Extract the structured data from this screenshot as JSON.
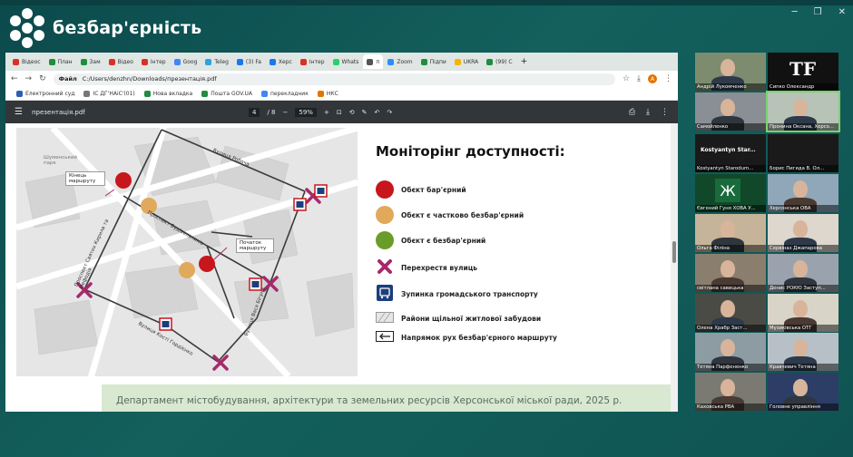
{
  "brand": {
    "name": "безбар'єрність"
  },
  "browser": {
    "tabs": [
      {
        "label": "Відеос",
        "color": "#d93025"
      },
      {
        "label": "План",
        "color": "#1e8e3e"
      },
      {
        "label": "Зам",
        "color": "#1e8e3e"
      },
      {
        "label": "Відео",
        "color": "#d93025"
      },
      {
        "label": "Інтер",
        "color": "#d93025"
      },
      {
        "label": "Goog",
        "color": "#4285f4"
      },
      {
        "label": "Teleg",
        "color": "#2aa3de"
      },
      {
        "label": "(3) Fa",
        "color": "#1877f2"
      },
      {
        "label": "Херс",
        "color": "#1877f2"
      },
      {
        "label": "Інтер",
        "color": "#d93025"
      },
      {
        "label": "Whats",
        "color": "#25d366"
      },
      {
        "label": "п",
        "color": "#555555"
      },
      {
        "label": "Zoom",
        "color": "#2d8cff"
      },
      {
        "label": "Підпи",
        "color": "#1e8e3e"
      },
      {
        "label": "UKRA",
        "color": "#f4b400"
      },
      {
        "label": "(99) С",
        "color": "#1e8e3e"
      }
    ],
    "address": {
      "scheme": "Файл",
      "path": "C:/Users/denzhn/Downloads/презентація.pdf"
    },
    "bookmarks": [
      "Електронний суд",
      "ІС ДГ'НАіС'(01)",
      "Нова вкладка",
      "Пошта GOV.UA",
      "перекладник",
      "НКС"
    ],
    "profile_initial": "A"
  },
  "pdf": {
    "filename": "презентація.pdf",
    "page_current": "4",
    "page_total": "/ 8",
    "zoom": "59%",
    "slide": {
      "title": "Моніторінг доступності:",
      "legend": [
        {
          "label": "Обєкт бар'єрний",
          "type": "dot",
          "color": "#c8161d"
        },
        {
          "label": "Обєкт є частково безбар'єрний",
          "type": "dot",
          "color": "#e0a95c"
        },
        {
          "label": "Обєкт є безбар'єрний",
          "type": "dot",
          "color": "#6a9c2a"
        },
        {
          "label": "Перехрестя вулиць",
          "type": "cross",
          "color": "#a52a6b"
        },
        {
          "label": "Зупинка громадського транспорту",
          "type": "bus",
          "color": "#1b3f7a"
        },
        {
          "label": "Райони щільної житлової забудови",
          "type": "hatch",
          "color": "#bdbdbd"
        },
        {
          "label": "Напрямок рух безбар'єрного маршруту",
          "type": "arrow",
          "color": "#222222"
        }
      ],
      "map_labels": {
        "end": "Кінець маршруту",
        "start": "Початок маршруту",
        "park": "Шуменський парк",
        "street1": "Вулиця Робоча",
        "street2": "Проспект Будівельників",
        "street3": "Проспект Святих Кирила та Мефодія",
        "street4": "Вулиця Вася Бігуна",
        "street5": "Вулиця Кості Гордієнко"
      },
      "footer": "Департамент містобудування, архітектури та земельних ресурсів Херсонської міської ради, 2025 р."
    }
  },
  "participants": [
    {
      "name": "Андрій Лукомченко",
      "bg": "#7d8c6e"
    },
    {
      "name": "Сипко Олександр",
      "bg": "#111111"
    },
    {
      "name": "Самойленко",
      "bg": "#8a8f95"
    },
    {
      "name": "Пронина Оксана, Херсо...",
      "bg": "#b7c3b6"
    },
    {
      "name": "Kostyantyn Starodum...",
      "bg": "#1a1a1a"
    },
    {
      "name": "Борис Пигида В. Ол...",
      "bg": "#1a1a1a"
    },
    {
      "name": "Євгений Гуня ХОВА У...",
      "bg": "#11482a"
    },
    {
      "name": "Херсонська ОВА",
      "bg": "#8fa7b8"
    },
    {
      "name": "Ольга Філіна",
      "bg": "#c5b49a"
    },
    {
      "name": "Сервіназ Джапарова",
      "bg": "#ddd7ce"
    },
    {
      "name": "світлана савицька",
      "bg": "#8a7f6e"
    },
    {
      "name": "Денис РОКЮ Заступ...",
      "bg": "#9aa3ad"
    },
    {
      "name": "Олена Храбр Заст...",
      "bg": "#4b4b46"
    },
    {
      "name": "Музиківська ОТГ",
      "bg": "#d9d4c8"
    },
    {
      "name": "Тетяна Парфененко",
      "bg": "#8c9ca2"
    },
    {
      "name": "Кравчевич Тетяна",
      "bg": "#b8c0c7"
    },
    {
      "name": "Каховська РВА",
      "bg": "#7a7a72"
    },
    {
      "name": "Головне управління",
      "bg": "#2c3e66"
    }
  ],
  "tile7_letter": "Ж",
  "tile2_letters": "TF",
  "tile5_name": "Kostyantyn Star..."
}
